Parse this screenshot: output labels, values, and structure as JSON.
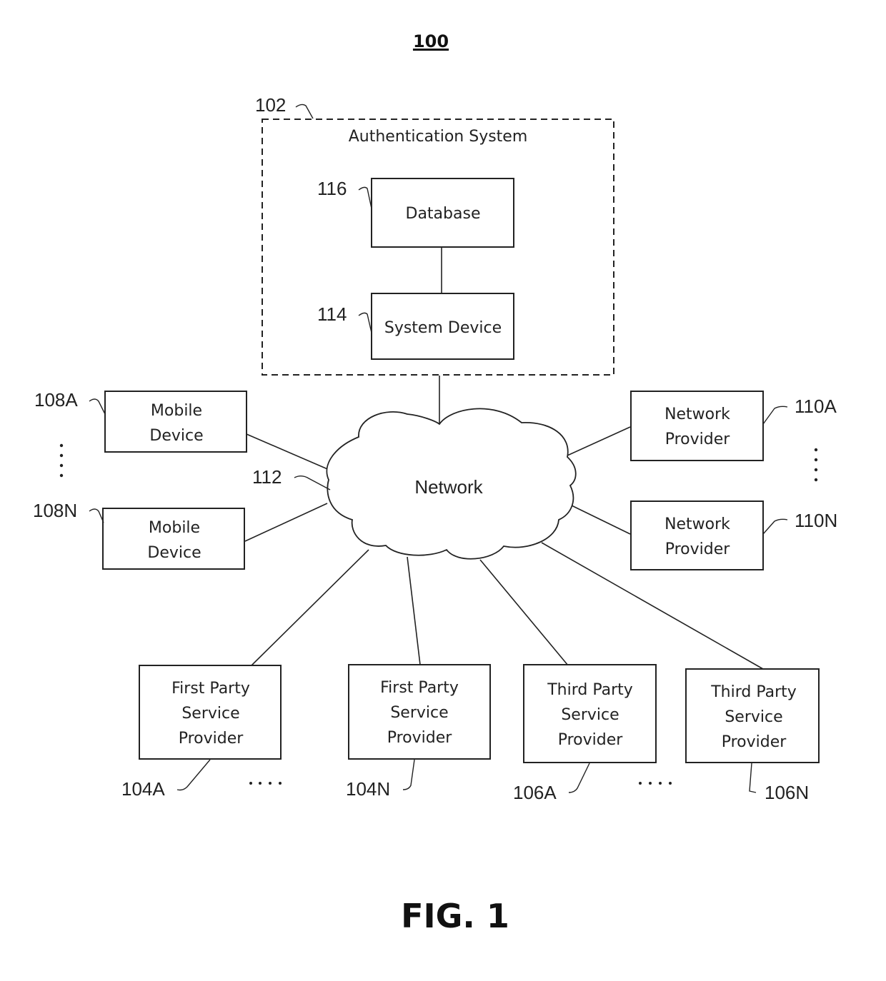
{
  "figure_number": "100",
  "caption": "FIG. 1",
  "authentication_system": {
    "ref": "102",
    "label": "Authentication System",
    "database": {
      "ref": "116",
      "label": "Database"
    },
    "system_device": {
      "ref": "114",
      "label": "System Device"
    }
  },
  "network": {
    "ref": "112",
    "label": "Network"
  },
  "mobile_devices": [
    {
      "ref": "108A",
      "line1": "Mobile",
      "line2": "Device"
    },
    {
      "ref": "108N",
      "line1": "Mobile",
      "line2": "Device"
    }
  ],
  "network_providers": [
    {
      "ref": "110A",
      "line1": "Network",
      "line2": "Provider"
    },
    {
      "ref": "110N",
      "line1": "Network",
      "line2": "Provider"
    }
  ],
  "service_providers": [
    {
      "ref": "104A",
      "line1": "First Party",
      "line2": "Service",
      "line3": "Provider"
    },
    {
      "ref": "104N",
      "line1": "First Party",
      "line2": "Service",
      "line3": "Provider"
    },
    {
      "ref": "106A",
      "line1": "Third Party",
      "line2": "Service",
      "line3": "Provider"
    },
    {
      "ref": "106N",
      "line1": "Third Party",
      "line2": "Service",
      "line3": "Provider"
    }
  ]
}
